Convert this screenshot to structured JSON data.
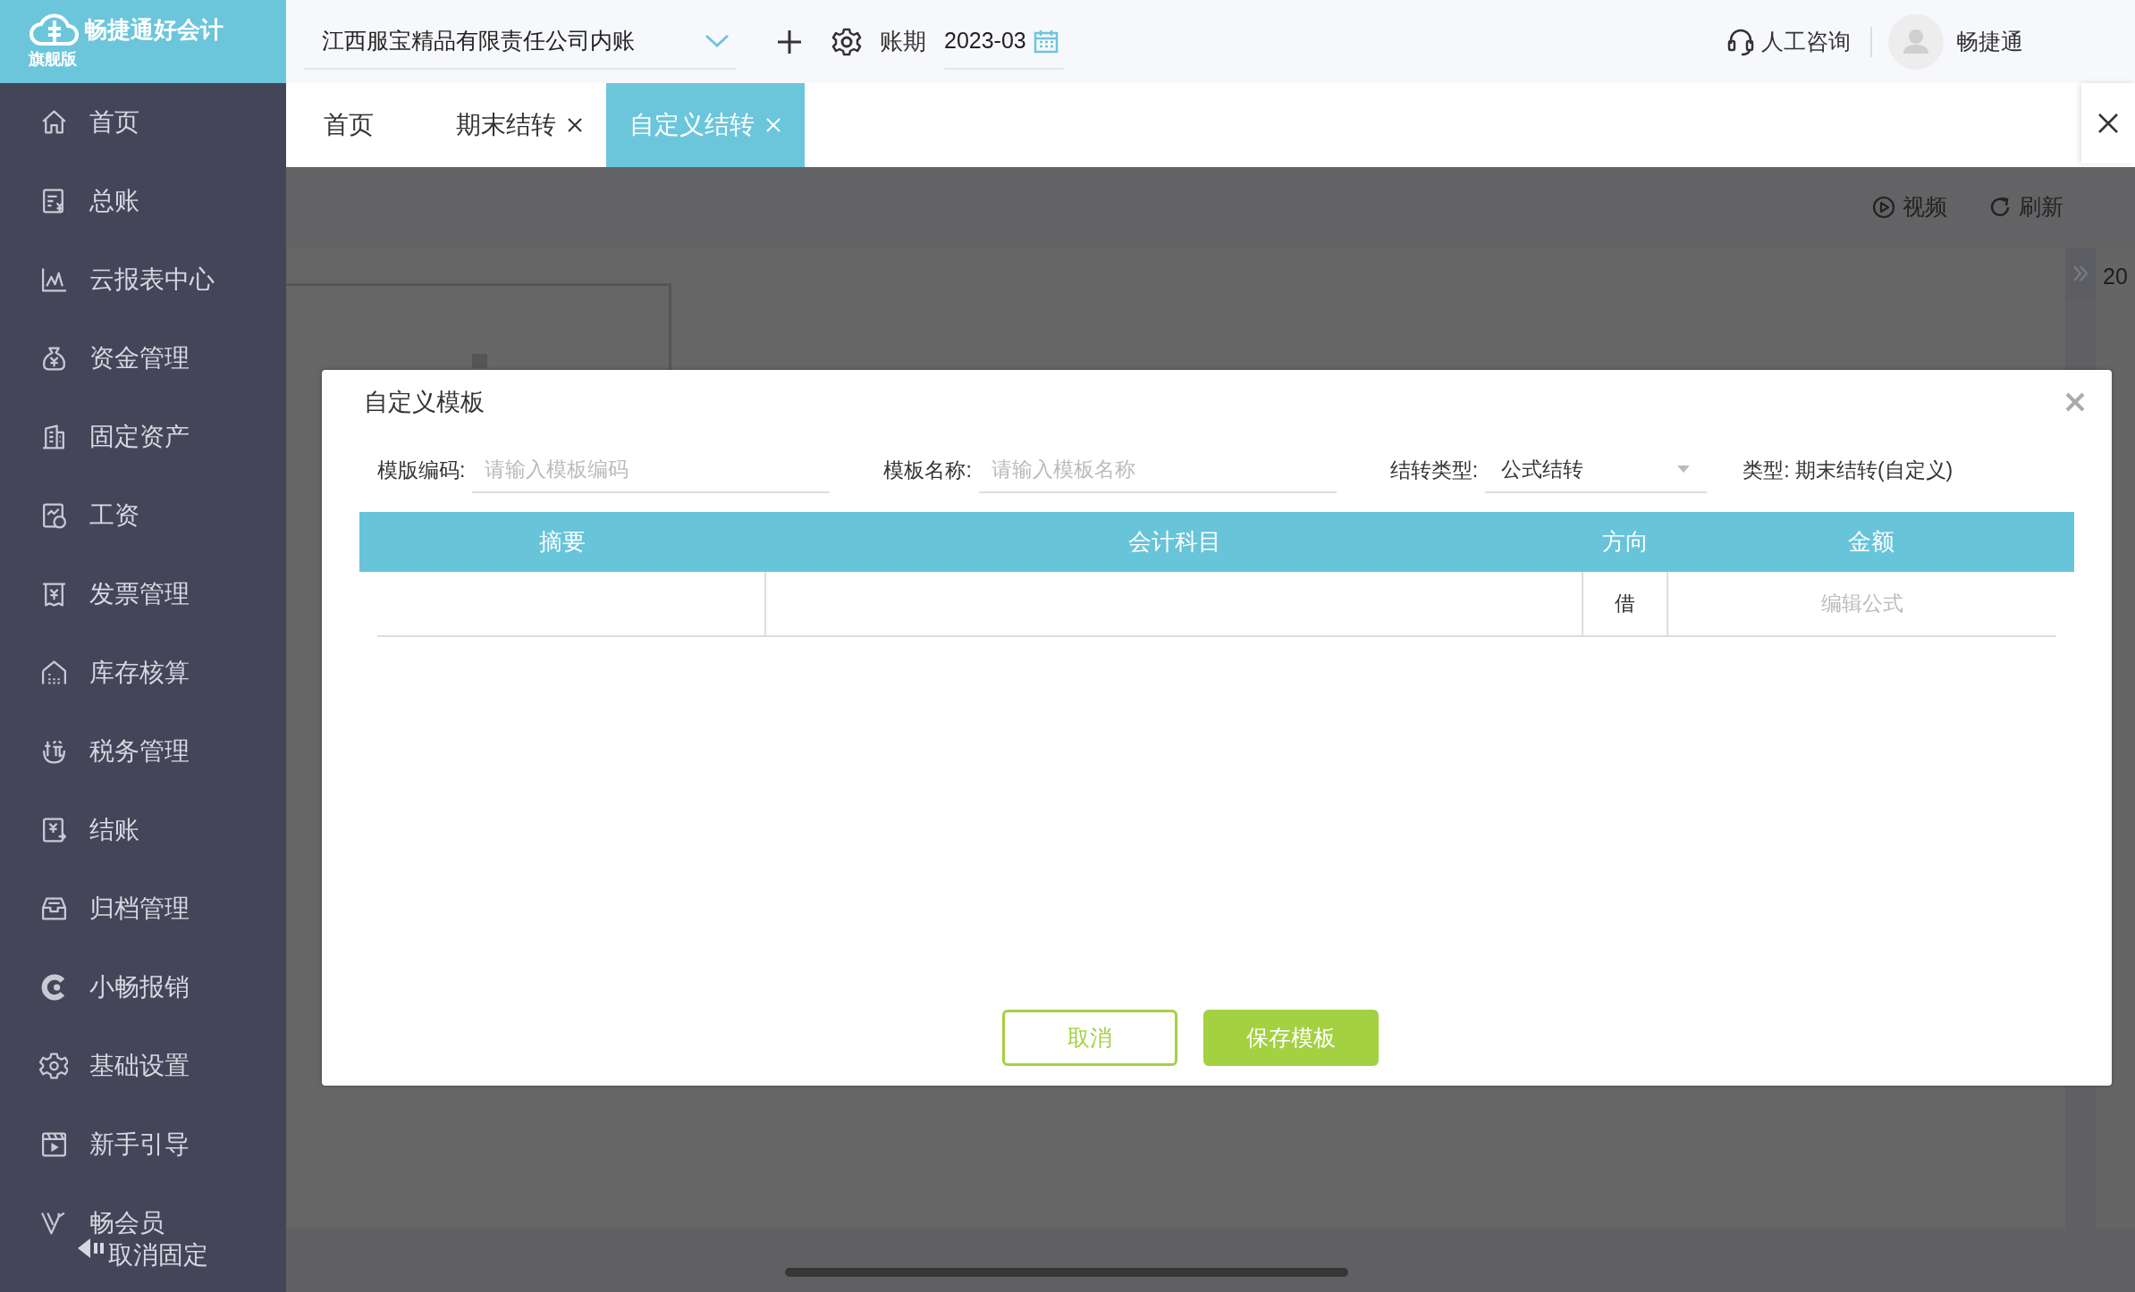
{
  "logo": {
    "name": "畅捷通好会计",
    "edition": "旗舰版"
  },
  "header": {
    "company": "江西服宝精品有限责任公司内账",
    "period_label": "账期",
    "period": "2023-03",
    "consult": "人工咨询",
    "user": "畅捷通"
  },
  "tabs": [
    {
      "label": "首页",
      "closable": false,
      "selected": false
    },
    {
      "label": "期末结转",
      "closable": true,
      "selected": false
    },
    {
      "label": "自定义结转",
      "closable": true,
      "selected": true
    }
  ],
  "toolbar": [
    "视频",
    "刷新"
  ],
  "background_text": "20",
  "sidebar": {
    "items": [
      {
        "label": "首页"
      },
      {
        "label": "总账"
      },
      {
        "label": "云报表中心"
      },
      {
        "label": "资金管理"
      },
      {
        "label": "固定资产"
      },
      {
        "label": "工资"
      },
      {
        "label": "发票管理"
      },
      {
        "label": "库存核算"
      },
      {
        "label": "税务管理"
      },
      {
        "label": "结账"
      },
      {
        "label": "归档管理"
      },
      {
        "label": "小畅报销"
      },
      {
        "label": "基础设置"
      },
      {
        "label": "新手引导"
      },
      {
        "label": "畅会员"
      }
    ],
    "footer": "取消固定"
  },
  "dialog": {
    "title": "自定义模板",
    "fields": [
      {
        "kind": "input",
        "label": "模版编码:",
        "placeholder": "请输入模板编码"
      },
      {
        "kind": "input",
        "label": "模板名称:",
        "placeholder": "请输入模板名称"
      },
      {
        "kind": "select",
        "label": "结转类型:",
        "value": "公式结转"
      }
    ],
    "type_info": "类型: 期末结转(自定义)",
    "columns": [
      "摘要",
      "会计科目",
      "方向",
      "金额"
    ],
    "rows": [
      {
        "direction": "借",
        "amount_placeholder": "编辑公式"
      }
    ],
    "buttons": [
      {
        "kind": "secondary",
        "label": "取消"
      },
      {
        "kind": "primary",
        "label": "保存模板"
      }
    ]
  }
}
